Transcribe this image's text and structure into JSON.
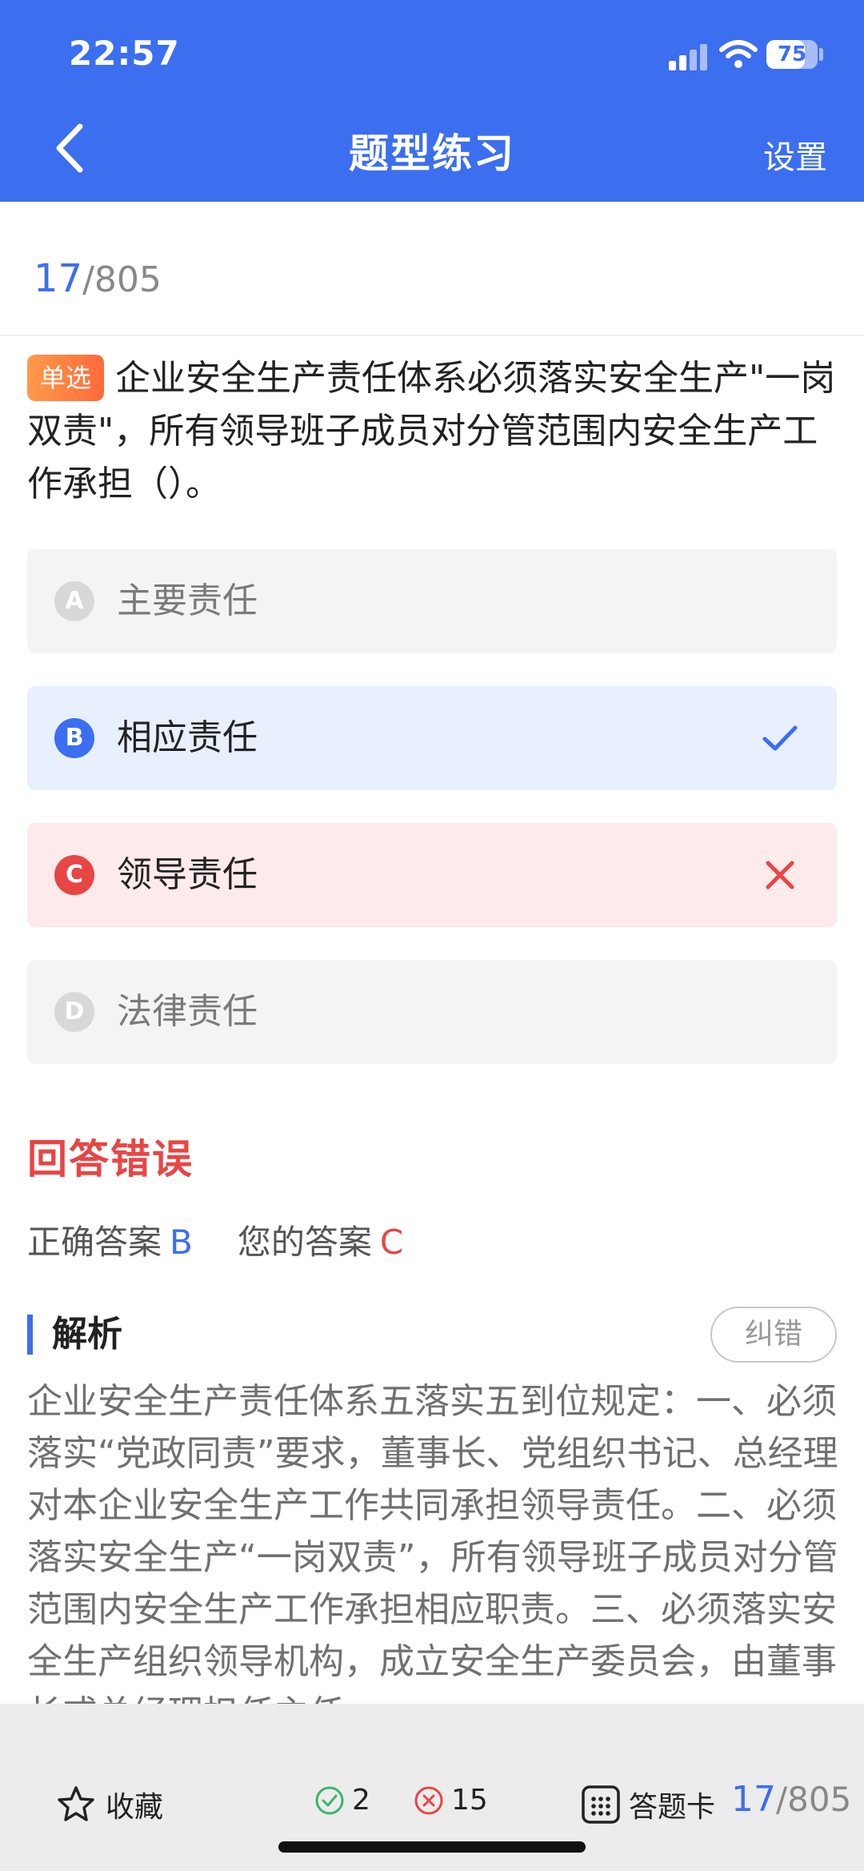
{
  "status_bar": {
    "time": "22:57",
    "battery": "75",
    "battery_level": 0.75
  },
  "nav": {
    "title": "题型练习",
    "settings_label": "设置"
  },
  "progress": {
    "current": "17",
    "total": "/805"
  },
  "question": {
    "type_badge": "单选",
    "text": "企业安全生产责任体系必须落实安全生产\"一岗双责\"，所有领导班子成员对分管范围内安全生产工作承担（）。"
  },
  "options": [
    {
      "letter": "A",
      "text": "主要责任",
      "state": "normal"
    },
    {
      "letter": "B",
      "text": "相应责任",
      "state": "correct"
    },
    {
      "letter": "C",
      "text": "领导责任",
      "state": "wrong"
    },
    {
      "letter": "D",
      "text": "法律责任",
      "state": "normal"
    }
  ],
  "result": {
    "title": "回答错误",
    "correct_label": "正确答案",
    "correct_value": "B",
    "yours_label": "您的答案",
    "yours_value": "C"
  },
  "analysis": {
    "heading": "解析",
    "report_label": "纠错",
    "text": "企业安全生产责任体系五落实五到位规定：一、必须落实“党政同责”要求，董事长、党组织书记、总经理对本企业安全生产工作共同承担领导责任。二、必须落实安全生产“一岗双责”，所有领导班子成员对分管范围内安全生产工作承担相应职责。三、必须落实安全生产组织领导机构，成立安全生产委员会，由董事长或总经理担任主任。"
  },
  "bottom_bar": {
    "favorite_label": "收藏",
    "right_count": "2",
    "wrong_count": "15",
    "answer_card_label": "答题卡",
    "progress_current": "17",
    "progress_total": "/805"
  },
  "colors": {
    "primary": "#3c6ef0",
    "error": "#e84545",
    "badge": "#ff7a3d"
  },
  "icons": [
    "back-arrow-icon",
    "checkmark-icon",
    "close-icon",
    "star-icon",
    "check-circle-icon",
    "x-circle-icon",
    "grid-icon"
  ]
}
